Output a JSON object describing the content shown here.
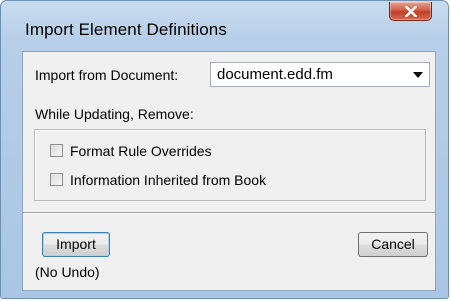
{
  "dialog": {
    "title": "Import Element Definitions",
    "close_glyph": "X"
  },
  "import_from": {
    "label": "Import from Document:",
    "selected": "document.edd.fm",
    "icon": "chevron-down-icon"
  },
  "while_updating": {
    "label": "While Updating, Remove:",
    "options": [
      {
        "label": "Format Rule Overrides",
        "checked": false
      },
      {
        "label": "Information Inherited from Book",
        "checked": false
      }
    ]
  },
  "buttons": {
    "import_label": "Import",
    "cancel_label": "Cancel"
  },
  "no_undo_text": "(No Undo)",
  "colors": {
    "titlebar": "#b6cee8",
    "client": "#f0f0f0",
    "close_button": "#c0402a"
  }
}
